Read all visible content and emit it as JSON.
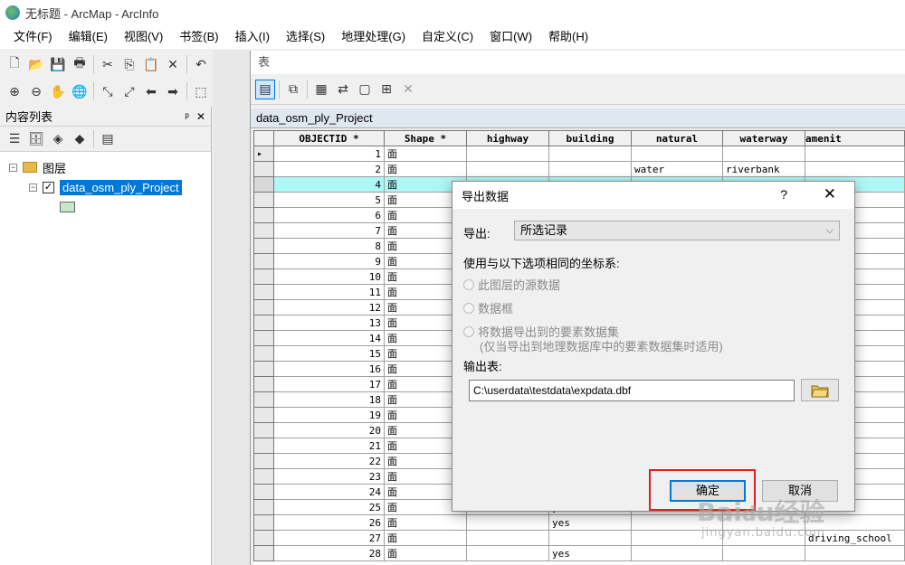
{
  "window": {
    "title": "无标题 - ArcMap - ArcInfo"
  },
  "menu": [
    "文件(F)",
    "编辑(E)",
    "视图(V)",
    "书签(B)",
    "插入(I)",
    "选择(S)",
    "地理处理(G)",
    "自定义(C)",
    "窗口(W)",
    "帮助(H)"
  ],
  "toc": {
    "title": "内容列表",
    "pin": "ᵖ",
    "close": "✕",
    "group_label": "图层",
    "layer_label": "data_osm_ply_Project"
  },
  "table_window": {
    "title": "表",
    "tab_label": "data_osm_ply_Project",
    "columns": [
      "OBJECTID *",
      "Shape *",
      "highway",
      "building",
      "natural",
      "waterway",
      "amenit"
    ],
    "rows": [
      {
        "oid": "1",
        "shape": "面",
        "building": "",
        "natural": "",
        "waterway": "",
        "amenity": ""
      },
      {
        "oid": "2",
        "shape": "面",
        "building": "",
        "natural": "water",
        "waterway": "riverbank",
        "amenity": ""
      },
      {
        "oid": "4",
        "shape": "面",
        "building": "",
        "natural": "",
        "waterway": "",
        "amenity": ""
      },
      {
        "oid": "5",
        "shape": "面",
        "building": "",
        "natural": "",
        "waterway": "",
        "amenity": ""
      },
      {
        "oid": "6",
        "shape": "面",
        "building": "",
        "natural": "",
        "waterway": "",
        "amenity": ""
      },
      {
        "oid": "7",
        "shape": "面",
        "building": "",
        "natural": "",
        "waterway": "",
        "amenity": ""
      },
      {
        "oid": "8",
        "shape": "面",
        "building": "",
        "natural": "",
        "waterway": "",
        "amenity": ""
      },
      {
        "oid": "9",
        "shape": "面",
        "building": "",
        "natural": "",
        "waterway": "",
        "amenity": ""
      },
      {
        "oid": "10",
        "shape": "面",
        "building": "",
        "natural": "",
        "waterway": "",
        "amenity": ""
      },
      {
        "oid": "11",
        "shape": "面",
        "building": "",
        "natural": "",
        "waterway": "",
        "amenity": ""
      },
      {
        "oid": "12",
        "shape": "面",
        "building": "",
        "natural": "",
        "waterway": "",
        "amenity": ""
      },
      {
        "oid": "13",
        "shape": "面",
        "building": "",
        "natural": "",
        "waterway": "",
        "amenity": ""
      },
      {
        "oid": "14",
        "shape": "面",
        "building": "",
        "natural": "",
        "waterway": "",
        "amenity": ""
      },
      {
        "oid": "15",
        "shape": "面",
        "building": "",
        "natural": "",
        "waterway": "",
        "amenity": ""
      },
      {
        "oid": "16",
        "shape": "面",
        "building": "",
        "natural": "",
        "waterway": "",
        "amenity": ""
      },
      {
        "oid": "17",
        "shape": "面",
        "building": "",
        "natural": "",
        "waterway": "",
        "amenity": ""
      },
      {
        "oid": "18",
        "shape": "面",
        "building": "",
        "natural": "",
        "waterway": "",
        "amenity": ""
      },
      {
        "oid": "19",
        "shape": "面",
        "building": "",
        "natural": "",
        "waterway": "",
        "amenity": ""
      },
      {
        "oid": "20",
        "shape": "面",
        "building": "",
        "natural": "",
        "waterway": "",
        "amenity": ""
      },
      {
        "oid": "21",
        "shape": "面",
        "building": "",
        "natural": "",
        "waterway": "",
        "amenity": ""
      },
      {
        "oid": "22",
        "shape": "面",
        "building": "",
        "natural": "",
        "waterway": "",
        "amenity": ""
      },
      {
        "oid": "23",
        "shape": "面",
        "building": "",
        "natural": "",
        "waterway": "",
        "amenity": ""
      },
      {
        "oid": "24",
        "shape": "面",
        "building": "",
        "natural": "",
        "waterway": "",
        "amenity": ""
      },
      {
        "oid": "25",
        "shape": "面",
        "building": "yes",
        "natural": "",
        "waterway": "",
        "amenity": ""
      },
      {
        "oid": "26",
        "shape": "面",
        "building": "yes",
        "natural": "",
        "waterway": "",
        "amenity": ""
      },
      {
        "oid": "27",
        "shape": "面",
        "building": "",
        "natural": "",
        "waterway": "",
        "amenity": "driving_school"
      },
      {
        "oid": "28",
        "shape": "面",
        "building": "yes",
        "natural": "",
        "waterway": "",
        "amenity": ""
      }
    ]
  },
  "dialog": {
    "title": "导出数据",
    "help": "?",
    "close": "✕",
    "export_label": "导出:",
    "export_value": "所选记录",
    "coord_label": "使用与以下选项相同的坐标系:",
    "radio1": "此图层的源数据",
    "radio2": "数据框",
    "radio3": "将数据导出到的要素数据集",
    "radio3_note": "(仅当导出到地理数据库中的要素数据集时适用)",
    "output_label": "输出表:",
    "output_path": "C:\\userdata\\testdata\\expdata.dbf",
    "ok": "确定",
    "cancel": "取消"
  },
  "watermark": {
    "main": "Baidu经验",
    "sub": "jingyan.baidu.com"
  },
  "colors": {
    "selection": "#0078d7",
    "highlight_row": "#aef7f7",
    "annotation_box": "#e02020"
  }
}
